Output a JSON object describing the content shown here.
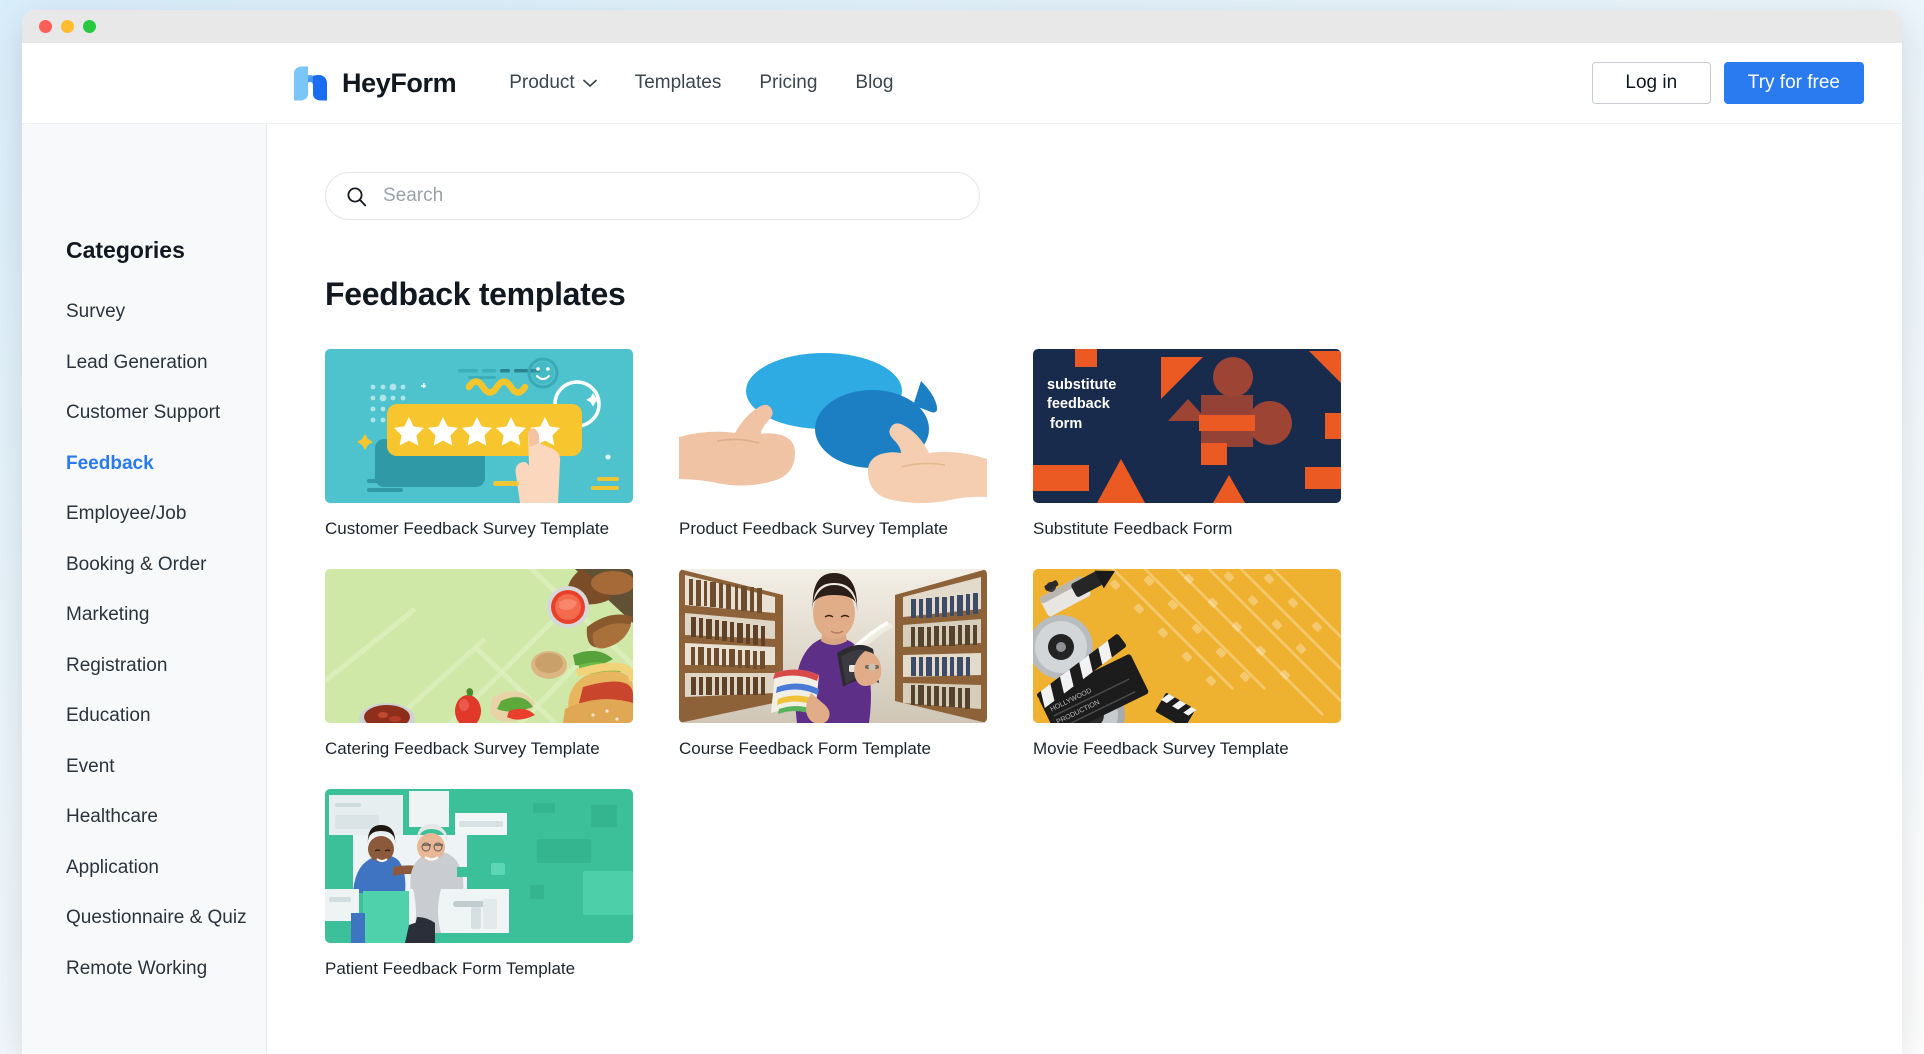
{
  "window": {
    "traffic_lights": [
      "close",
      "minimize",
      "maximize"
    ]
  },
  "header": {
    "brand_name": "HeyForm",
    "logo_icon": "heyform-logo-icon",
    "nav": [
      {
        "label": "Product",
        "has_dropdown": true,
        "icon": "chevron-down-icon"
      },
      {
        "label": "Templates",
        "has_dropdown": false
      },
      {
        "label": "Pricing",
        "has_dropdown": false
      },
      {
        "label": "Blog",
        "has_dropdown": false
      }
    ],
    "login_label": "Log in",
    "cta_label": "Try for free"
  },
  "search": {
    "placeholder": "Search",
    "value": "",
    "icon": "search-icon"
  },
  "sidebar": {
    "title": "Categories",
    "items": [
      {
        "label": "Survey",
        "active": false
      },
      {
        "label": "Lead Generation",
        "active": false
      },
      {
        "label": "Customer Support",
        "active": false
      },
      {
        "label": "Feedback",
        "active": true
      },
      {
        "label": "Employee/Job",
        "active": false
      },
      {
        "label": "Booking & Order",
        "active": false
      },
      {
        "label": "Marketing",
        "active": false
      },
      {
        "label": "Registration",
        "active": false
      },
      {
        "label": "Education",
        "active": false
      },
      {
        "label": "Event",
        "active": false
      },
      {
        "label": "Healthcare",
        "active": false
      },
      {
        "label": "Application",
        "active": false
      },
      {
        "label": "Questionnaire & Quiz",
        "active": false
      },
      {
        "label": "Remote Working",
        "active": false
      }
    ]
  },
  "main": {
    "title": "Feedback templates",
    "templates": [
      {
        "title": "Customer Feedback Survey Template",
        "thumb": "five-star-rating-teal",
        "overlay_text": ""
      },
      {
        "title": "Product Feedback Survey Template",
        "thumb": "thumbs-up-speech-bubbles",
        "overlay_text": ""
      },
      {
        "title": "Substitute Feedback Form",
        "thumb": "navy-orange-geometric",
        "overlay_text": "substitute feedback form"
      },
      {
        "title": "Catering Feedback Survey Template",
        "thumb": "food-tray-green",
        "overlay_text": ""
      },
      {
        "title": "Course Feedback Form Template",
        "thumb": "library-student-photo",
        "overlay_text": ""
      },
      {
        "title": "Movie Feedback Survey Template",
        "thumb": "cinema-yellow-filmstrip",
        "overlay_text": ""
      },
      {
        "title": "Patient Feedback Form Template",
        "thumb": "nurse-patient-green-mosaic",
        "overlay_text": ""
      }
    ]
  },
  "colors": {
    "accent": "#2a7bf0",
    "text": "#11181f",
    "muted": "#9aa1a8",
    "sidebar_bg": "#f8f9fa",
    "titlebar_bg": "#e8e8e8"
  }
}
